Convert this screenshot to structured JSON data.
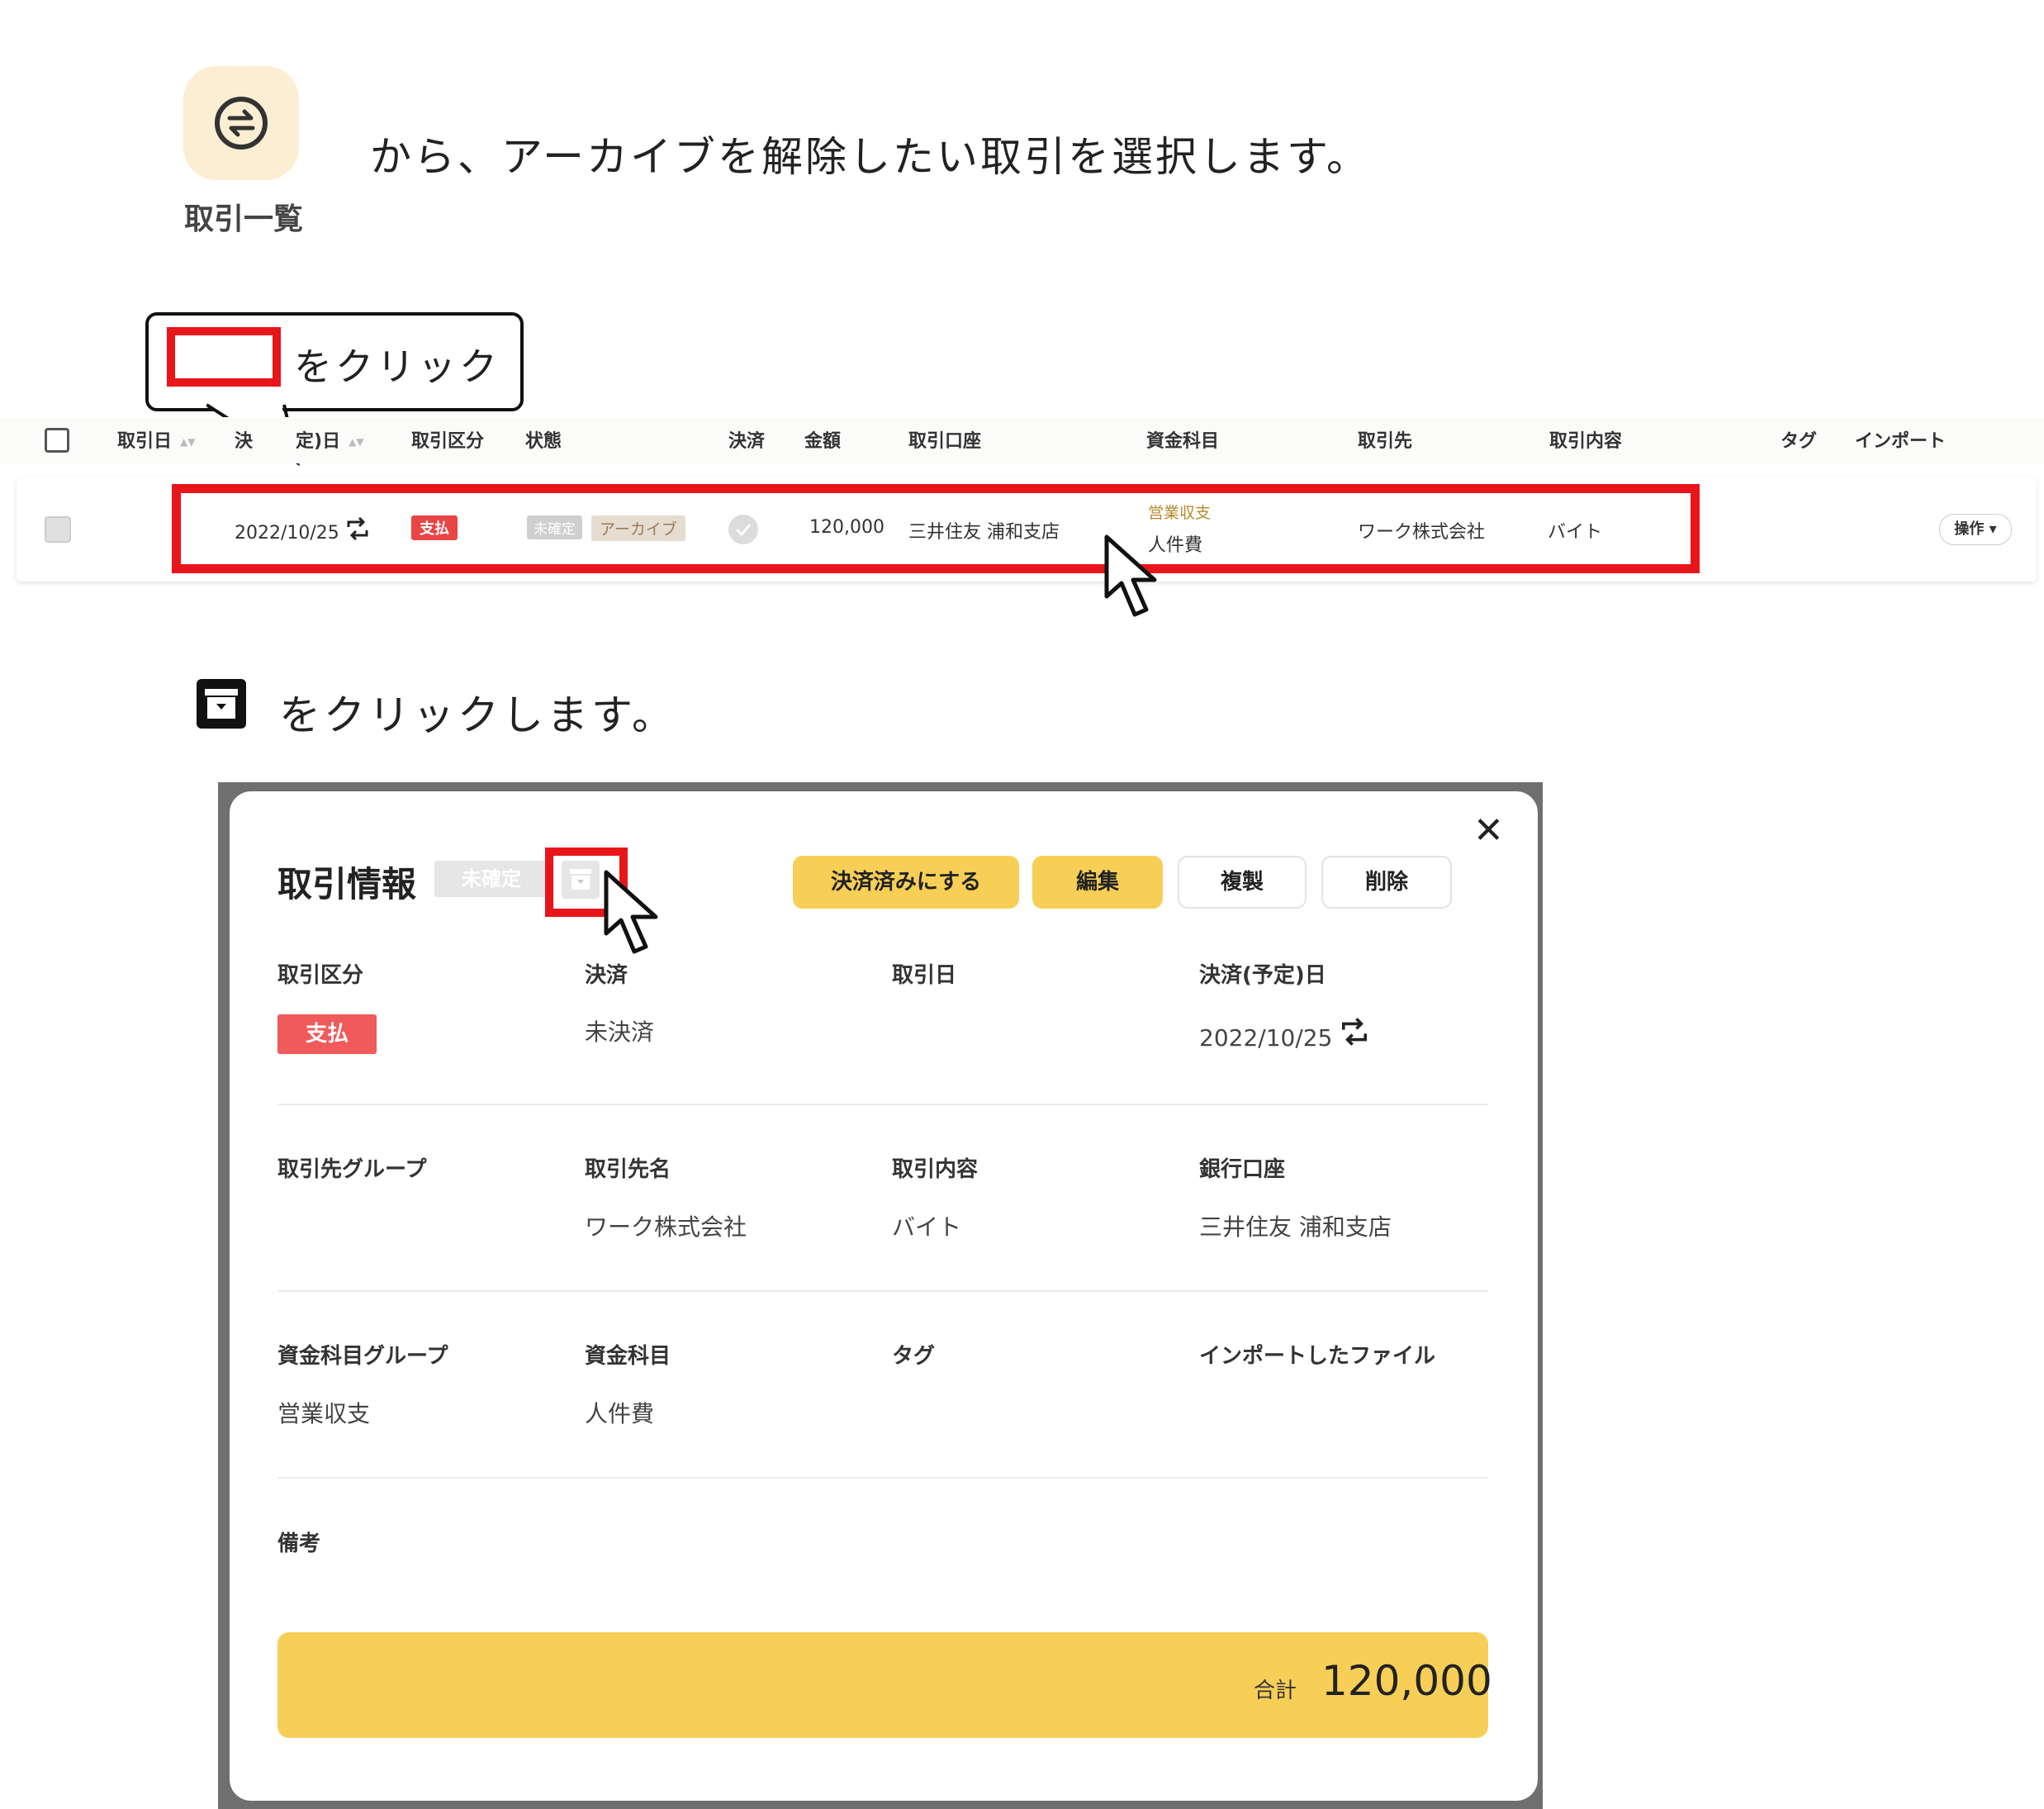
{
  "top_instruction": {
    "app_icon_label": "取引一覧",
    "text": "から、アーカイブを解除したい取引を選択します。"
  },
  "callout": {
    "text": "をクリック"
  },
  "table": {
    "headers": {
      "date": "取引日",
      "settle_date_part1": "決",
      "settle_date_part2": "定)日",
      "category": "取引区分",
      "status": "状態",
      "settled": "決済",
      "amount": "金額",
      "account": "取引口座",
      "fund_item": "資金科目",
      "partner": "取引先",
      "content": "取引内容",
      "tag": "タグ",
      "import": "インポート"
    },
    "row": {
      "settle_date": "2022/10/25",
      "category_badge": "支払",
      "status_badge": "未確定",
      "archive_badge": "アーカイブ",
      "amount": "120,000",
      "account": "三井住友 浦和支店",
      "fund_group": "営業収支",
      "fund_item": "人件費",
      "partner": "ワーク株式会社",
      "content": "バイト",
      "op_button": "操作 ▾"
    }
  },
  "second_instruction": {
    "text": "をクリックします。"
  },
  "modal": {
    "title": "取引情報",
    "status_badge": "未確定",
    "close": "✕",
    "buttons": {
      "settle": "決済済みにする",
      "edit": "編集",
      "duplicate": "複製",
      "delete": "削除"
    },
    "fields": {
      "category_label": "取引区分",
      "category_value": "支払",
      "settled_label": "決済",
      "settled_value": "未決済",
      "date_label": "取引日",
      "settle_date_label": "決済(予定)日",
      "settle_date_value": "2022/10/25",
      "partner_group_label": "取引先グループ",
      "partner_name_label": "取引先名",
      "partner_name_value": "ワーク株式会社",
      "content_label": "取引内容",
      "content_value": "バイト",
      "bank_label": "銀行口座",
      "bank_value": "三井住友 浦和支店",
      "fund_group_label": "資金科目グループ",
      "fund_group_value": "営業収支",
      "fund_item_label": "資金科目",
      "fund_item_value": "人件費",
      "tag_label": "タグ",
      "import_label": "インポートしたファイル",
      "memo_label": "備考"
    },
    "total_label": "合計",
    "total_value": "120,000"
  },
  "colors": {
    "accent_red": "#e8151b",
    "brand_yellow": "#f7cf57",
    "pay_badge": "#f05a5a"
  },
  "icons": [
    "exchange-icon",
    "recurring-icon",
    "check-icon",
    "archive-icon",
    "close-icon",
    "mouse-cursor-icon"
  ]
}
